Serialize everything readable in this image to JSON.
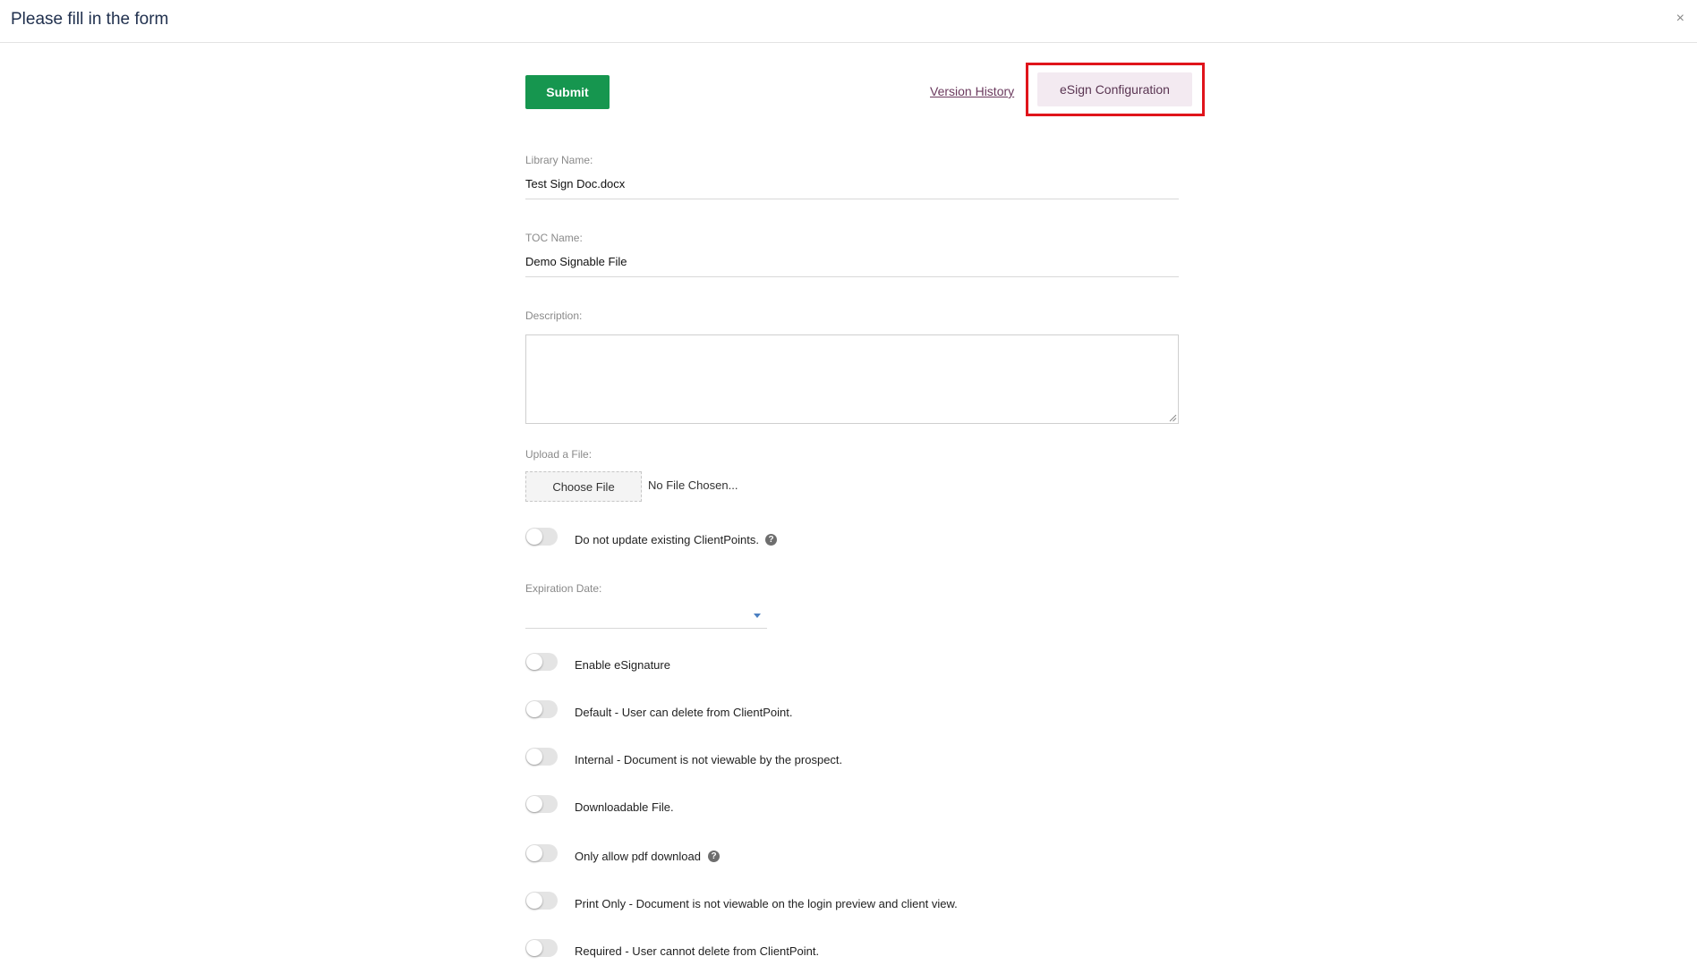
{
  "header": {
    "title": "Please fill in the form",
    "close_label": "×"
  },
  "toolbar": {
    "submit_label": "Submit",
    "version_history_label": "Version History",
    "esign_config_label": "eSign Configuration"
  },
  "fields": {
    "library_name": {
      "label": "Library Name:",
      "value": "Test Sign Doc.docx"
    },
    "toc_name": {
      "label": "TOC Name:",
      "value": "Demo Signable File"
    },
    "description": {
      "label": "Description:",
      "value": ""
    },
    "upload": {
      "label": "Upload a File:",
      "button_label": "Choose File",
      "status": "No File Chosen..."
    },
    "expiration_date": {
      "label": "Expiration Date:",
      "value": ""
    }
  },
  "toggles": [
    {
      "label": "Do not update existing ClientPoints.",
      "on": false,
      "help": true
    },
    {
      "label": "Enable eSignature",
      "on": false,
      "help": false
    },
    {
      "label": "Default - User can delete from ClientPoint.",
      "on": false,
      "help": false
    },
    {
      "label": "Internal - Document is not viewable by the prospect.",
      "on": false,
      "help": false
    },
    {
      "label": "Downloadable File.",
      "on": false,
      "help": false
    },
    {
      "label": "Only allow pdf download",
      "on": false,
      "help": true
    },
    {
      "label": "Print Only - Document is not viewable on the login preview and client view.",
      "on": false,
      "help": false
    },
    {
      "label": "Required - User cannot delete from ClientPoint.",
      "on": false,
      "help": false
    }
  ],
  "icons": {
    "help": "question-circle-icon",
    "close": "close-icon",
    "dropdown": "chevron-down-icon"
  },
  "colors": {
    "submit": "#16964f",
    "highlight": "#e0141b",
    "esign_bg": "#f3eaf1",
    "link": "#6b3a5e"
  }
}
